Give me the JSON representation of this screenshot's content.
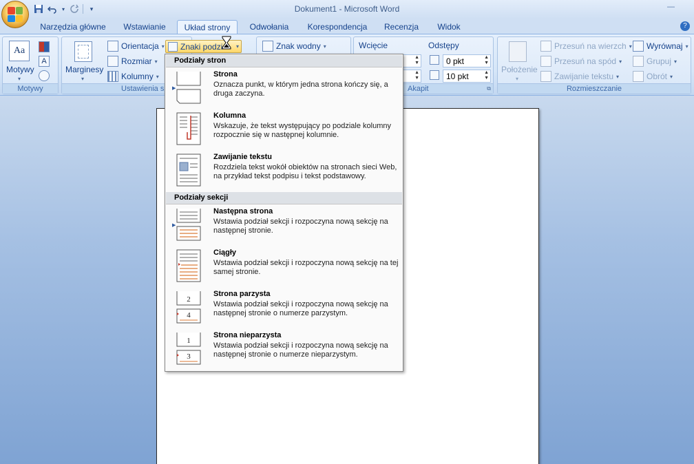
{
  "window": {
    "title": "Dokument1 - Microsoft Word",
    "controls": "—"
  },
  "quick_access": {
    "save_icon": "save-icon",
    "undo_icon": "undo-icon",
    "redo_icon": "redo-icon",
    "customize_icon": "customize-icon"
  },
  "tabs": [
    {
      "label": "Narzędzia główne"
    },
    {
      "label": "Wstawianie"
    },
    {
      "label": "Układ strony"
    },
    {
      "label": "Odwołania"
    },
    {
      "label": "Korespondencja"
    },
    {
      "label": "Recenzja"
    },
    {
      "label": "Widok"
    }
  ],
  "ribbon": {
    "motywy": {
      "button": "Motywy",
      "group_label": "Motywy"
    },
    "page_setup": {
      "marginesy": "Marginesy",
      "orientacja": "Orientacja",
      "rozmiar": "Rozmiar",
      "kolumny": "Kolumny",
      "znaki_podzialu": "Znaki podziału",
      "group_label": "Ustawienia s"
    },
    "tlo": {
      "znak_wodny": "Znak wodny"
    },
    "akapit": {
      "wciecie": "Wcięcie",
      "odstepy": "Odstępy",
      "odstep_przed": "0 pkt",
      "odstep_po": "10 pkt",
      "group_label": "Akapit"
    },
    "rozmieszczanie": {
      "polozenie": "Położenie",
      "przesun_wierzch": "Przesuń na wierzch",
      "przesun_spod": "Przesuń na spód",
      "zawijanie": "Zawijanie tekstu",
      "wyrownaj": "Wyrównaj",
      "grupuj": "Grupuj",
      "obrot": "Obrót",
      "group_label": "Rozmieszczanie"
    }
  },
  "menu": {
    "section_pages": "Podziały stron",
    "section_sections": "Podziały sekcji",
    "items": [
      {
        "title": "Strona",
        "desc": "Oznacza punkt, w którym jedna strona kończy się, a druga zaczyna.",
        "icon": "page-break-icon"
      },
      {
        "title": "Kolumna",
        "desc": "Wskazuje, że tekst występujący po podziale kolumny rozpocznie się w następnej kolumnie.",
        "icon": "column-break-icon"
      },
      {
        "title": "Zawijanie tekstu",
        "desc": "Rozdziela tekst wokół obiektów na stronach sieci Web, na przykład tekst podpisu i tekst podstawowy.",
        "icon": "text-wrapping-break-icon"
      },
      {
        "title": "Następna strona",
        "desc": "Wstawia podział sekcji i rozpoczyna nową sekcję na następnej stronie.",
        "icon": "next-page-section-icon"
      },
      {
        "title": "Ciągły",
        "desc": "Wstawia podział sekcji i rozpoczyna nową sekcję na tej samej stronie.",
        "icon": "continuous-section-icon"
      },
      {
        "title": "Strona parzysta",
        "desc": "Wstawia podział sekcji i rozpoczyna nową sekcję na następnej stronie o numerze parzystym.",
        "icon": "even-page-section-icon",
        "num_top": "2",
        "num_bottom": "4"
      },
      {
        "title": "Strona nieparzysta",
        "desc": "Wstawia podział sekcji i rozpoczyna nową sekcję na następnej stronie o numerze nieparzystym.",
        "icon": "odd-page-section-icon",
        "num_top": "1",
        "num_bottom": "3"
      }
    ]
  },
  "colors": {
    "accent": "#15428b",
    "highlight": "#ffd768",
    "menu_header_bg": "#dde1e6"
  }
}
